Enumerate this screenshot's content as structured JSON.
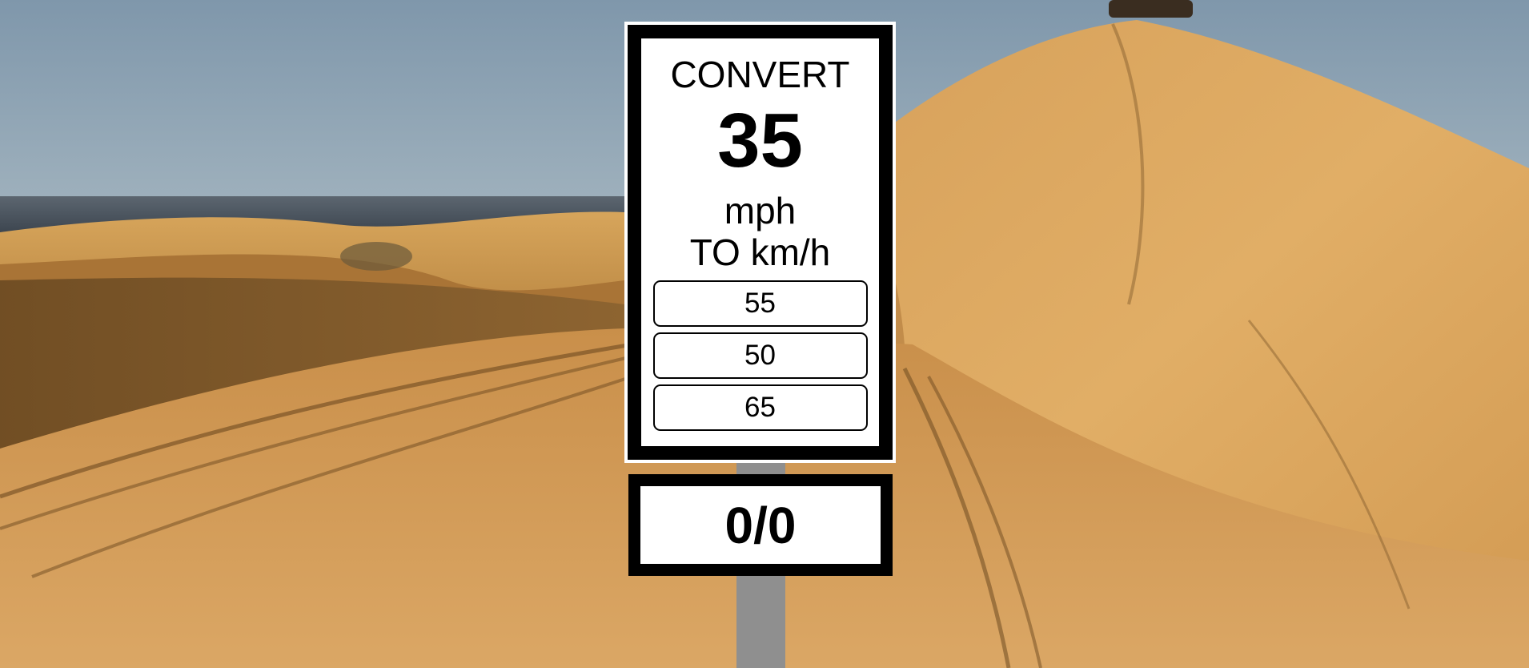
{
  "sign": {
    "title": "CONVERT",
    "value": "35",
    "unit": "mph",
    "target": "TO km/h"
  },
  "options": [
    {
      "label": "55"
    },
    {
      "label": "50"
    },
    {
      "label": "65"
    }
  ],
  "score": {
    "text": "0/0"
  }
}
